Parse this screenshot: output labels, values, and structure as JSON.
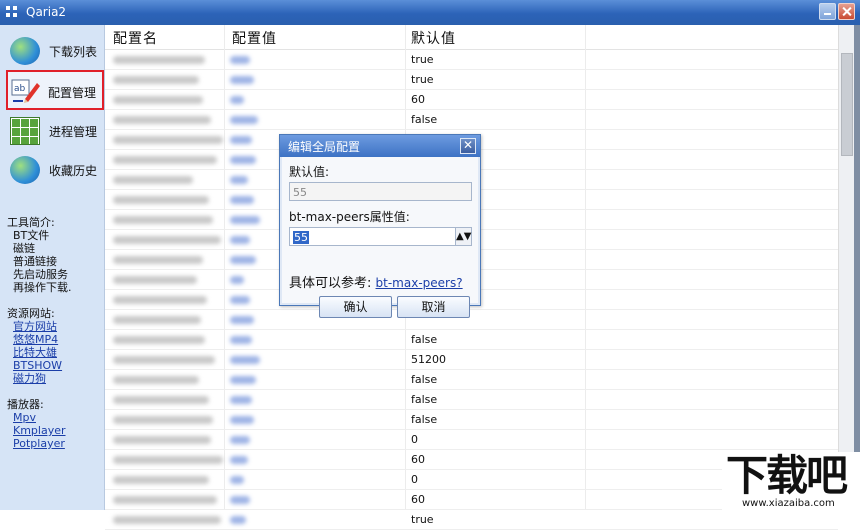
{
  "window": {
    "title": "Qaria2"
  },
  "sidebar": {
    "items": [
      {
        "label": "下载列表",
        "icon": "globe-link-icon"
      },
      {
        "label": "配置管理",
        "icon": "edit-pencil-icon",
        "selected": true
      },
      {
        "label": "进程管理",
        "icon": "grid-table-icon"
      },
      {
        "label": "收藏历史",
        "icon": "globe-upload-icon"
      }
    ],
    "intro": {
      "heading": "工具简介:",
      "lines": [
        "BT文件",
        "磁链",
        "普通链接",
        "先启动服务",
        "再操作下载."
      ]
    },
    "resources": {
      "heading": "资源网站:",
      "links": [
        "官方网站",
        "悠悠MP4",
        "比特大雄",
        "BTSHOW",
        "磁力狗"
      ]
    },
    "players": {
      "heading": "播放器:",
      "links": [
        "Mpv",
        "Kmplayer",
        "Potplayer"
      ]
    }
  },
  "table": {
    "headers": [
      "配置名",
      "配置值",
      "默认值"
    ],
    "rows": [
      {
        "default": "true"
      },
      {
        "default": "true"
      },
      {
        "default": "60"
      },
      {
        "default": "false"
      },
      {
        "default": ""
      },
      {
        "default": ""
      },
      {
        "default": ""
      },
      {
        "default": ""
      },
      {
        "default": ""
      },
      {
        "default": ""
      },
      {
        "default": ""
      },
      {
        "default": ""
      },
      {
        "default": ""
      },
      {
        "default": ""
      },
      {
        "default": "false"
      },
      {
        "default": "51200"
      },
      {
        "default": "false"
      },
      {
        "default": "false"
      },
      {
        "default": "false"
      },
      {
        "default": "0"
      },
      {
        "default": "60"
      },
      {
        "default": "0"
      },
      {
        "default": "60"
      },
      {
        "default": "true"
      }
    ]
  },
  "dialog": {
    "title": "编辑全局配置",
    "default_label": "默认值:",
    "default_value": "55",
    "attr_label": "bt-max-peers属性值:",
    "attr_value": "55",
    "ref_text": "具体可以参考:",
    "ref_link": "bt-max-peers?",
    "ok": "确认",
    "cancel": "取消"
  },
  "watermark": {
    "main": "下载吧",
    "sub": "www.xiazaiba.com"
  }
}
